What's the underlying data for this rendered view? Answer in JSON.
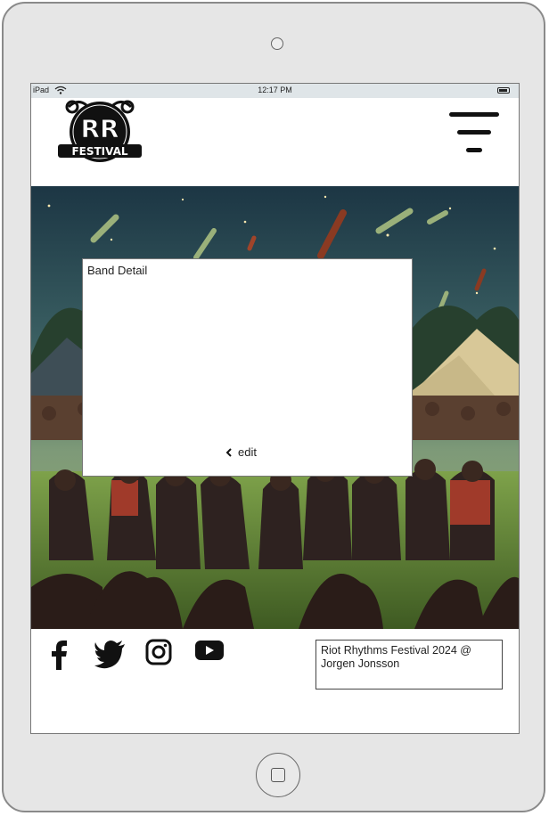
{
  "statusbar": {
    "carrier": "iPad",
    "time": "12:17 PM"
  },
  "header": {
    "logo_text": "RR",
    "logo_subtext": "FESTIVAL"
  },
  "modal": {
    "title": "Band Detail",
    "edit_label": "edit"
  },
  "footer": {
    "social": [
      "facebook-icon",
      "twitter-icon",
      "instagram-icon",
      "youtube-icon"
    ],
    "copyright": " Riot Rhythms Festival 2024 @ Jorgen Jonsson"
  },
  "colors": {
    "sky_top": "#1e3b4a",
    "sky_bottom": "#6a8a7a",
    "grass": "#6a9a3a",
    "crowd": "#3a2620"
  }
}
